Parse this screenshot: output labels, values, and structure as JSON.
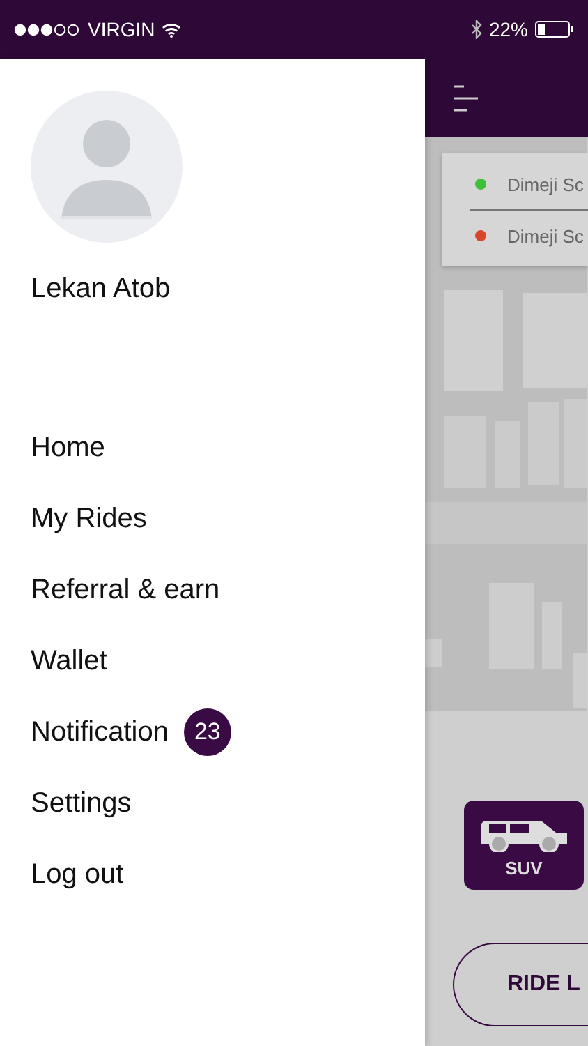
{
  "status_bar": {
    "carrier": "VIRGIN",
    "battery": "22%"
  },
  "drawer": {
    "profile": {
      "name": "Lekan Atob"
    },
    "items": [
      {
        "label": "Home"
      },
      {
        "label": "My Rides"
      },
      {
        "label": "Referral & earn"
      },
      {
        "label": "Wallet"
      },
      {
        "label": "Notification",
        "badge": "23"
      },
      {
        "label": "Settings"
      },
      {
        "label": "Log out"
      }
    ]
  },
  "locations": [
    {
      "text": "Dimeji Sc",
      "color": "#3fbf3a"
    },
    {
      "text": "Dimeji Sc",
      "color": "#d9452b"
    }
  ],
  "vehicles": [
    {
      "label": "SUV",
      "selected": true
    }
  ],
  "ride_button": {
    "label": "RIDE L"
  }
}
